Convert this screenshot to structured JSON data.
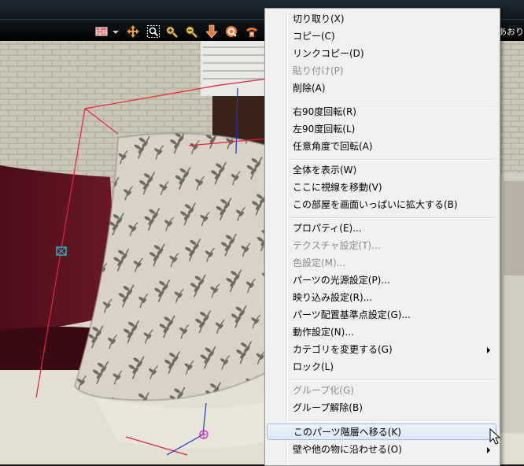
{
  "toolbar": {
    "icons": [
      "wall-texture-icon",
      "dropdown-arrow-icon",
      "move-icon",
      "zoom-region-icon",
      "zoom-in-icon",
      "zoom-out-icon",
      "walk-down-icon",
      "rotate-view-icon",
      "reset-view-icon"
    ],
    "right_label": "あおり"
  },
  "context_menu": {
    "items": [
      {
        "label": "切り取り(X)",
        "disabled": false
      },
      {
        "label": "コピー(C)",
        "disabled": false
      },
      {
        "label": "リンクコピー(D)",
        "disabled": false
      },
      {
        "label": "貼り付け(P)",
        "disabled": true
      },
      {
        "label": "削除(A)",
        "disabled": false
      },
      {
        "label": "右90度回転(R)",
        "disabled": false
      },
      {
        "label": "左90度回転(L)",
        "disabled": false
      },
      {
        "label": "任意角度で回転(A)",
        "disabled": false
      },
      {
        "label": "全体を表示(W)",
        "disabled": false
      },
      {
        "label": "ここに視線を移動(V)",
        "disabled": false
      },
      {
        "label": "この部屋を画面いっぱいに拡大する(B)",
        "disabled": false
      },
      {
        "label": "プロパティ(E)...",
        "disabled": false
      },
      {
        "label": "テクスチャ設定(T)...",
        "disabled": true
      },
      {
        "label": "色設定(M)...",
        "disabled": true
      },
      {
        "label": "パーツの光源設定(P)...",
        "disabled": false
      },
      {
        "label": "映り込み設定(R)...",
        "disabled": false
      },
      {
        "label": "パーツ配置基準点設定(G)...",
        "disabled": false
      },
      {
        "label": "動作設定(N)...",
        "disabled": false
      },
      {
        "label": "カテゴリを変更する(G)",
        "disabled": false,
        "submenu": true
      },
      {
        "label": "ロック(L)",
        "disabled": false
      },
      {
        "label": "グループ化(G)",
        "disabled": true
      },
      {
        "label": "グループ解除(B)",
        "disabled": false
      },
      {
        "label": "このパーツ階層へ移る(K)",
        "disabled": false,
        "highlighted": true
      },
      {
        "label": "壁や他の物に沿わせる(O)",
        "disabled": false,
        "submenu": true
      }
    ]
  },
  "colors": {
    "menu_bg": "#f0f0f0",
    "highlight_border": "#9ebde4",
    "disabled_text": "#8c8c8c",
    "selection_wire": "#e8203c",
    "axis_blue": "#2030d0"
  }
}
